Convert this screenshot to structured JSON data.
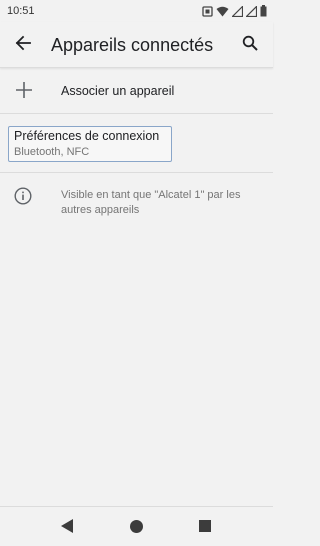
{
  "status_bar": {
    "time": "10:51",
    "icons": [
      "notification-square-icon",
      "wifi-icon",
      "signal-icon",
      "signal-icon",
      "battery-icon"
    ]
  },
  "app_bar": {
    "title": "Appareils connectés",
    "back_icon": "arrow-back-icon",
    "search_icon": "search-icon"
  },
  "items": {
    "add_device": {
      "icon": "plus-icon",
      "label": "Associer un appareil"
    },
    "connection_prefs": {
      "title": "Préférences de connexion",
      "subtitle": "Bluetooth, NFC"
    },
    "info": {
      "icon": "info-icon",
      "text": "Visible en tant que \"Alcatel 1\" par les autres appareils"
    }
  },
  "nav_bar": {
    "back": "nav-back-triangle-icon",
    "home": "nav-home-circle-icon",
    "recents": "nav-recents-square-icon"
  },
  "colors": {
    "background": "#f2f2f2",
    "text_primary": "#202124",
    "text_secondary": "#757575",
    "focus_border": "#8aa6c9"
  }
}
